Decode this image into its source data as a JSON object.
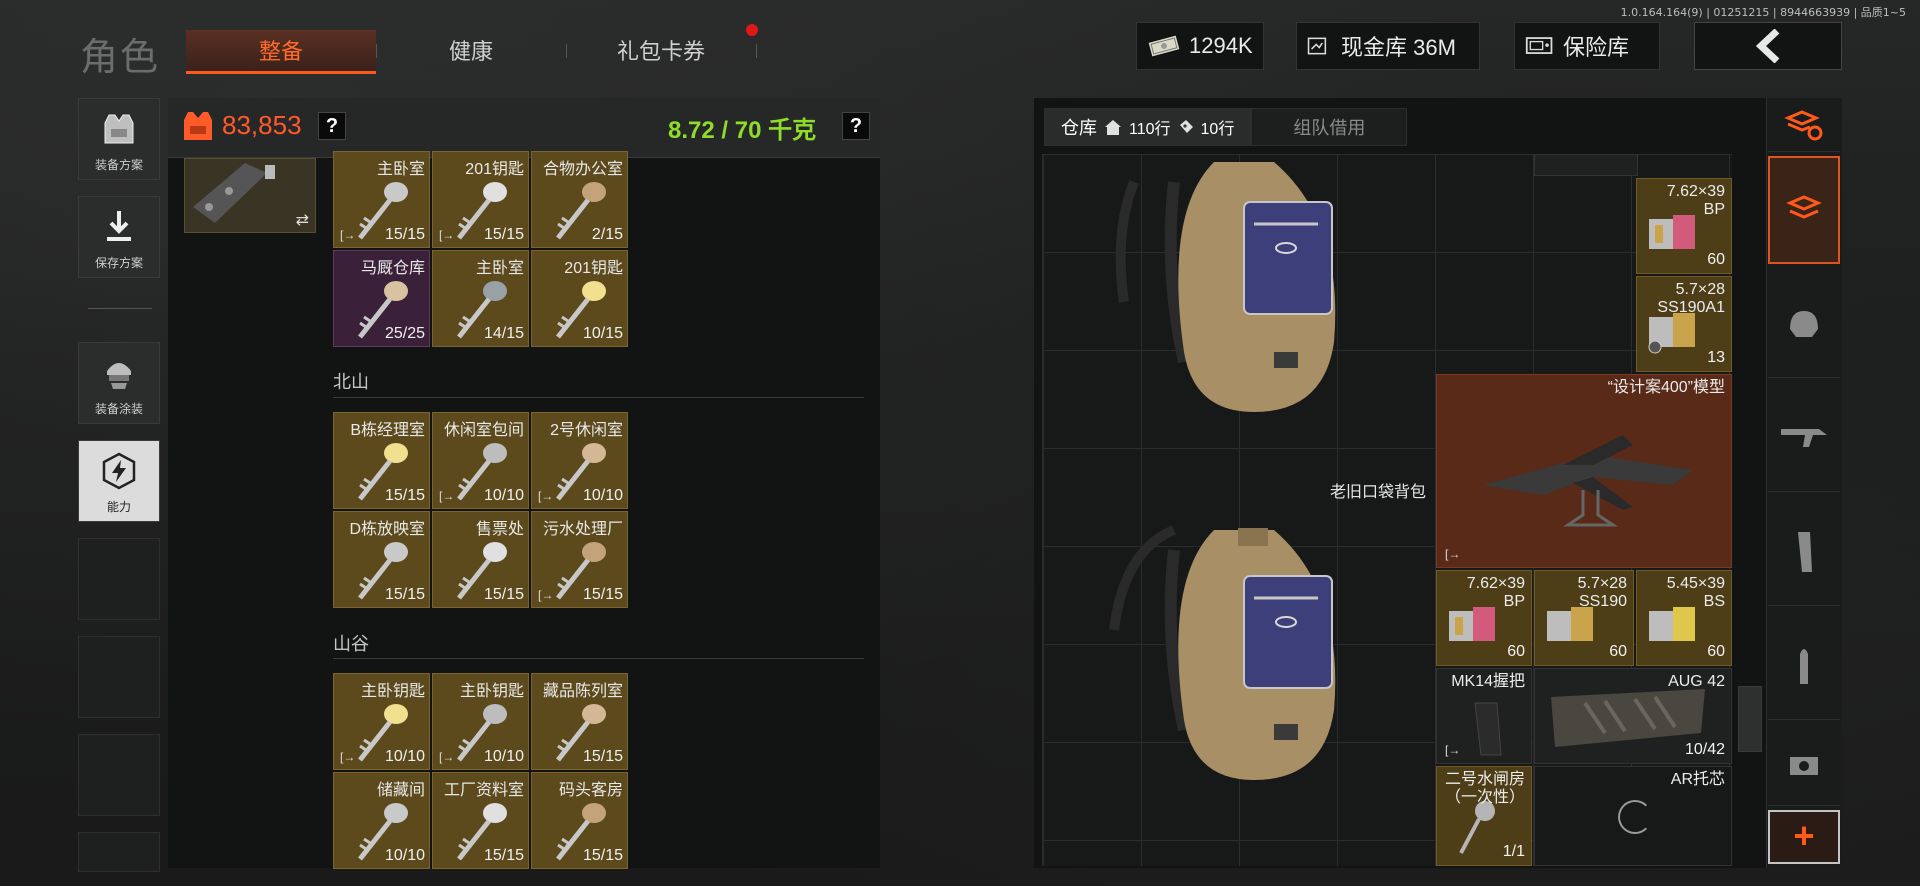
{
  "version": "1.0.164.164(9) | 01251215 | 8944663939 | 品质1~5",
  "header": {
    "title": "角色",
    "tabs": [
      {
        "label": "整备",
        "active": true
      },
      {
        "label": "健康",
        "active": false
      },
      {
        "label": "礼包卡券",
        "active": false,
        "notify": true
      }
    ],
    "cash": "1294K",
    "cash_vault": "现金库 36M",
    "safe_vault": "保险库"
  },
  "left_rail": {
    "loadout": "装备方案",
    "save": "保存方案",
    "skin": "装备涂装",
    "ability": "能力"
  },
  "equipment": {
    "value": "83,853",
    "weight": "8.72 / 70 千克",
    "help": "?"
  },
  "keys_top": [
    {
      "name": "主卧室",
      "count": "15/15",
      "exit": true
    },
    {
      "name": "201钥匙",
      "count": "15/15",
      "exit": true
    },
    {
      "name": "合物办公室",
      "count": "2/15",
      "exit": false
    },
    {
      "name": "马厩仓库",
      "count": "25/25",
      "exit": false,
      "rarity": "purple"
    },
    {
      "name": "主卧室",
      "count": "14/15",
      "exit": false
    },
    {
      "name": "201钥匙",
      "count": "10/15",
      "exit": false
    }
  ],
  "sections": [
    {
      "title": "北山",
      "keys": [
        {
          "name": "B栋经理室",
          "count": "15/15",
          "exit": false
        },
        {
          "name": "休闲室包间",
          "count": "10/10",
          "exit": true
        },
        {
          "name": "2号休闲室",
          "count": "10/10",
          "exit": true
        },
        {
          "name": "D栋放映室",
          "count": "15/15",
          "exit": false
        },
        {
          "name": "售票处",
          "count": "15/15",
          "exit": false
        },
        {
          "name": "污水处理厂",
          "count": "15/15",
          "exit": true
        }
      ]
    },
    {
      "title": "山谷",
      "keys": [
        {
          "name": "主卧钥匙",
          "count": "10/10",
          "exit": true
        },
        {
          "name": "主卧钥匙",
          "count": "10/10",
          "exit": true
        },
        {
          "name": "藏品陈列室",
          "count": "15/15",
          "exit": false
        },
        {
          "name": "储藏间",
          "count": "10/10",
          "exit": false
        },
        {
          "name": "工厂资料室",
          "count": "15/15",
          "exit": false
        },
        {
          "name": "码头客房",
          "count": "15/15",
          "exit": false
        }
      ]
    }
  ],
  "warehouse": {
    "tab_label": "仓库",
    "rows_home": "110行",
    "rows_ticket": "10行",
    "team_borrow": "组队借用",
    "backpack_label": "老旧口袋背包",
    "items": [
      {
        "name": "7.62×39\nBP",
        "count": "60"
      },
      {
        "name": "5.7×28\nSS190A1",
        "count": "13"
      },
      {
        "name": "“设计案400”模型",
        "count": ""
      },
      {
        "name": "7.62×39\nBP",
        "count": "60"
      },
      {
        "name": "5.7×28\nSS190",
        "count": "60"
      },
      {
        "name": "5.45×39\nBS",
        "count": "60"
      },
      {
        "name": "MK14握把",
        "count": ""
      },
      {
        "name": "AUG 42",
        "count": "10/42"
      },
      {
        "name": "二号水闸房\n（一次性）",
        "count": "1/1"
      },
      {
        "name": "AR托芯",
        "count": ""
      }
    ]
  },
  "colors": {
    "accent": "#ff5a1a",
    "gold_cell": "#5c4a1c",
    "purple_cell": "#3a2038",
    "weight_green": "#8fdd2a"
  }
}
